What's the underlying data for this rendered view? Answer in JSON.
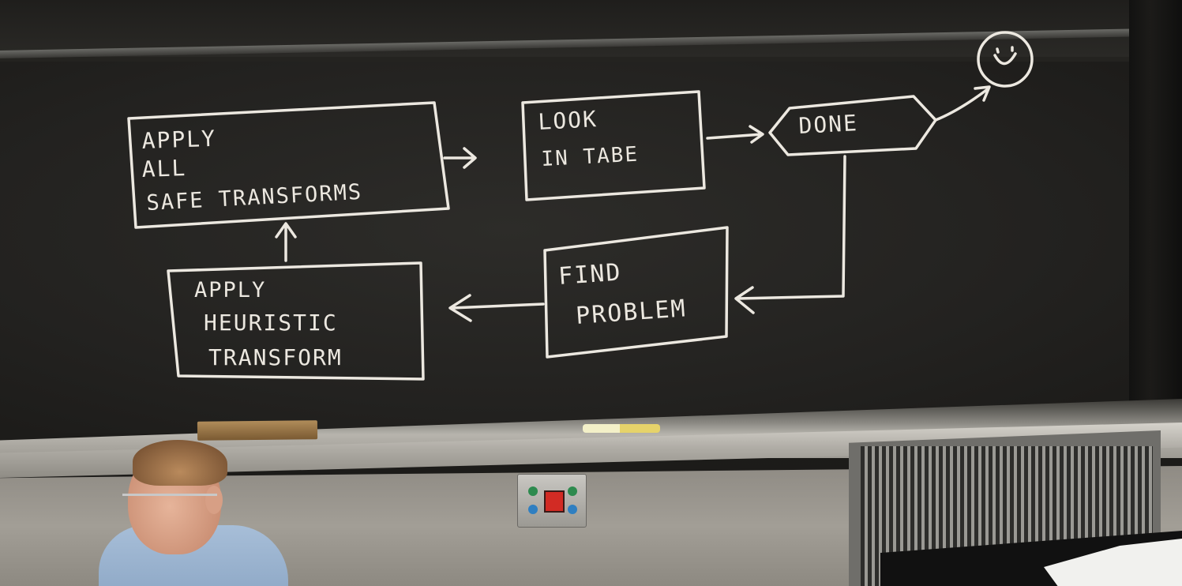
{
  "diagram": {
    "boxes": {
      "apply_safe": [
        "APPLY",
        "ALL",
        "SAFE TRANSFORMS"
      ],
      "look_in_table": [
        "LOOK",
        "IN TABE"
      ],
      "done": "DONE",
      "find_problem": [
        "FIND",
        "PROBLEM"
      ],
      "apply_heuristic": [
        "APPLY",
        "HEURISTIC",
        "TRANSFORM"
      ]
    }
  },
  "colors": {
    "chalk": "#ece8e0",
    "board": "#252421",
    "tray": "#b7b4ad",
    "wall": "#9a968e",
    "shirt": "#a7bed8"
  },
  "icons": {
    "smiley": "smiley-face-icon"
  }
}
